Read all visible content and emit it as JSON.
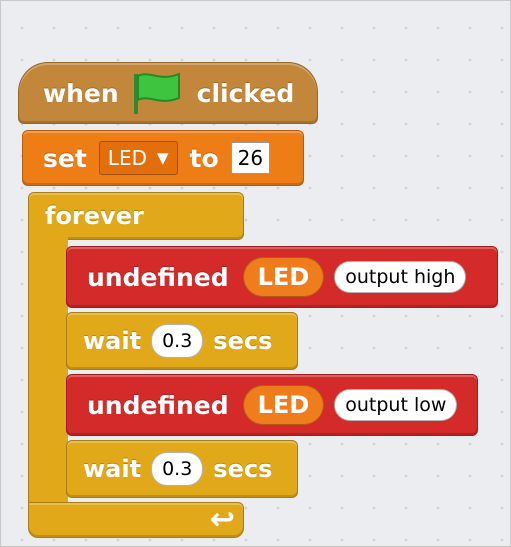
{
  "hat": {
    "when": "when",
    "clicked": "clicked",
    "flag_icon": "green-flag-icon",
    "color": "#c3873b"
  },
  "set_block": {
    "label_set": "set",
    "variable": "LED",
    "label_to": "to",
    "value": "26",
    "color": "#ee7d16"
  },
  "forever": {
    "label": "forever",
    "loop_icon": "↩",
    "color": "#e1a91a"
  },
  "blocks": [
    {
      "label": "undefined",
      "pin": "LED",
      "mode": "output high",
      "color": "#d42a2a"
    },
    {
      "label": "wait",
      "value": "0.3",
      "unit": "secs",
      "color": "#e1a91a"
    },
    {
      "label": "undefined",
      "pin": "LED",
      "mode": "output low",
      "color": "#d42a2a"
    },
    {
      "label": "wait",
      "value": "0.3",
      "unit": "secs",
      "color": "#e1a91a"
    }
  ]
}
